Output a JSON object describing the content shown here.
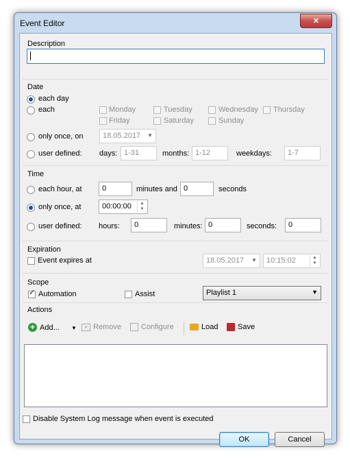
{
  "window": {
    "title": "Event Editor",
    "close_glyph": "✕"
  },
  "description": {
    "label": "Description",
    "value": ""
  },
  "date": {
    "label": "Date",
    "each_day": "each day",
    "each": "each",
    "weekdays": [
      "Monday",
      "Tuesday",
      "Wednesday",
      "Thursday",
      "Friday",
      "Saturday",
      "Sunday"
    ],
    "only_once_on": "only once, on",
    "only_once_value": "18.05.2017",
    "user_defined": "user defined:",
    "days_label": "days:",
    "days_value": "1-31",
    "months_label": "months:",
    "months_value": "1-12",
    "weekdays_label": "weekdays:",
    "weekdays_value": "1-7",
    "selected": "each day"
  },
  "time": {
    "label": "Time",
    "each_hour_at": "each hour, at",
    "each_hour_minutes": "0",
    "minutes_and": "minutes and",
    "each_hour_seconds": "0",
    "seconds": "seconds",
    "only_once_at": "only once, at",
    "only_once_value": "00:00:00",
    "user_defined": "user defined:",
    "hours_label": "hours:",
    "hours_value": "0",
    "minutes_label": "minutes:",
    "minutes_value": "0",
    "seconds_label": "seconds:",
    "seconds_value": "0",
    "selected": "only once, at"
  },
  "expiration": {
    "label": "Expiration",
    "checkbox": "Event expires at",
    "checked": false,
    "date_value": "18.05.2017",
    "time_value": "10:15:02"
  },
  "scope": {
    "label": "Scope",
    "automation": "Automation",
    "automation_checked": true,
    "assist": "Assist",
    "assist_checked": false,
    "playlist": "Playlist 1"
  },
  "actions": {
    "label": "Actions",
    "add": "Add...",
    "remove": "Remove",
    "configure": "Configure",
    "load": "Load",
    "save": "Save"
  },
  "footer": {
    "disable_log": "Disable System Log message when event is executed",
    "ok": "OK",
    "cancel": "Cancel"
  },
  "colors": {
    "window_frame": "#c9dbee",
    "client_bg": "#f0f0f0",
    "add_icon": "#2a9b3a",
    "save_icon": "#c0272d",
    "folder_icon": "#e7a826"
  }
}
